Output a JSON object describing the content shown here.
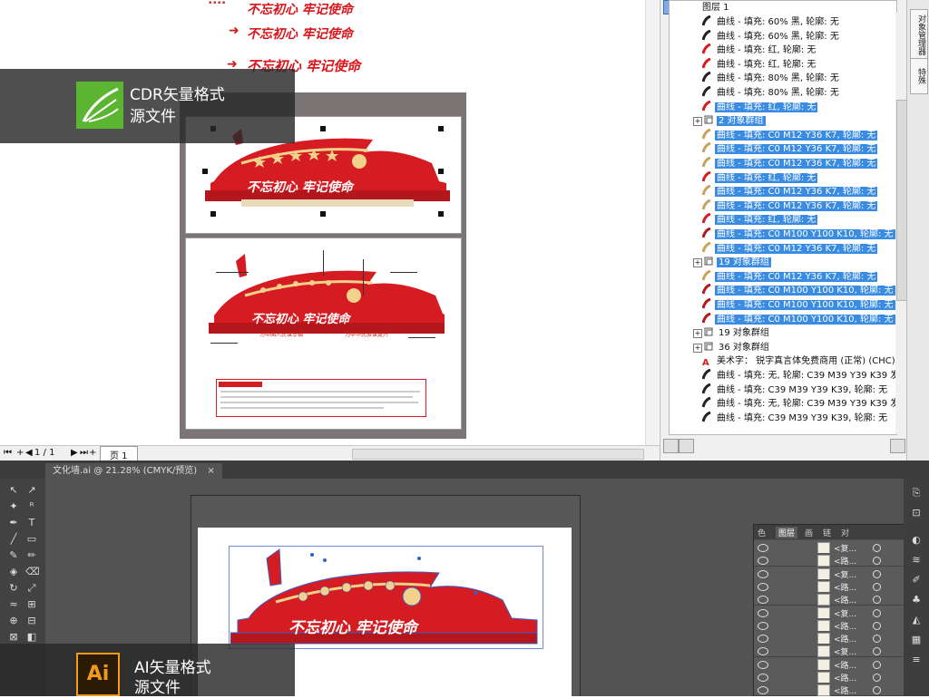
{
  "top_section": {
    "header_lines": [
      {
        "text": "不忘初心 牢记使命"
      },
      {
        "text": "不忘初心 牢记使命"
      },
      {
        "text": "不忘初心 牢记使命"
      }
    ],
    "badge": {
      "line1": "CDR矢量格式",
      "line2": "源文件"
    },
    "artboard_small_text": {
      "slogan": "不忘初心  牢记使命",
      "label_left": "为中国人民谋幸福",
      "label_right": "为中华民族谋复兴"
    },
    "statusbar": {
      "page_count": "1 / 1",
      "page_tab": "页 1"
    }
  },
  "object_tree": {
    "layer": "图层 1",
    "rows": [
      {
        "label": "曲线 - 填充: 60% 黑, 轮廓: 无",
        "selected": false,
        "icon_color": "#222222",
        "indent": 2
      },
      {
        "label": "曲线 - 填充: 60% 黑, 轮廓: 无",
        "selected": false,
        "icon_color": "#222222",
        "indent": 2
      },
      {
        "label": "曲线 - 填充: 红, 轮廓: 无",
        "selected": false,
        "icon_color": "#d41c22",
        "indent": 2
      },
      {
        "label": "曲线 - 填充: 红, 轮廓: 无",
        "selected": false,
        "icon_color": "#d41c22",
        "indent": 2
      },
      {
        "label": "曲线 - 填充: 80% 黑, 轮廓: 无",
        "selected": false,
        "icon_color": "#222222",
        "indent": 2
      },
      {
        "label": "曲线 - 填充: 80% 黑, 轮廓: 无",
        "selected": false,
        "icon_color": "#222222",
        "indent": 2
      },
      {
        "label": "曲线 - 填充: 红, 轮廓: 无",
        "selected": true,
        "icon_color": "#d41c22",
        "indent": 2
      },
      {
        "label": "2 对象群组",
        "selected": true,
        "group": true,
        "indent": 1
      },
      {
        "label": "曲线 - 填充: C0 M12 Y36 K7, 轮廓: 无",
        "selected": true,
        "icon_color": "#c9a35a",
        "indent": 2
      },
      {
        "label": "曲线 - 填充: C0 M12 Y36 K7, 轮廓: 无",
        "selected": true,
        "icon_color": "#c9a35a",
        "indent": 2
      },
      {
        "label": "曲线 - 填充: C0 M12 Y36 K7, 轮廓: 无",
        "selected": true,
        "icon_color": "#c9a35a",
        "indent": 2
      },
      {
        "label": "曲线 - 填充: 红, 轮廓: 无",
        "selected": true,
        "icon_color": "#d41c22",
        "indent": 2
      },
      {
        "label": "曲线 - 填充: C0 M12 Y36 K7, 轮廓: 无",
        "selected": true,
        "icon_color": "#c9a35a",
        "indent": 2
      },
      {
        "label": "曲线 - 填充: C0 M12 Y36 K7, 轮廓: 无",
        "selected": true,
        "icon_color": "#c9a35a",
        "indent": 2
      },
      {
        "label": "曲线 - 填充: 红, 轮廓: 无",
        "selected": true,
        "icon_color": "#d41c22",
        "indent": 2
      },
      {
        "label": "曲线 - 填充: C0 M100 Y100 K10, 轮廓: 无",
        "selected": true,
        "icon_color": "#b3161b",
        "indent": 2
      },
      {
        "label": "曲线 - 填充: C0 M12 Y36 K7, 轮廓: 无",
        "selected": true,
        "icon_color": "#c9a35a",
        "indent": 2
      },
      {
        "label": "19 对象群组",
        "selected": true,
        "group": true,
        "indent": 1
      },
      {
        "label": "曲线 - 填充: C0 M12 Y36 K7, 轮廓: 无",
        "selected": true,
        "icon_color": "#c9a35a",
        "indent": 2
      },
      {
        "label": "曲线 - 填充: C0 M100 Y100 K10, 轮廓: 无",
        "selected": true,
        "icon_color": "#b3161b",
        "indent": 2
      },
      {
        "label": "曲线 - 填充: C0 M100 Y100 K10, 轮廓: 无",
        "selected": true,
        "icon_color": "#b3161b",
        "indent": 2
      },
      {
        "label": "曲线 - 填充: C0 M100 Y100 K10, 轮廓: 无",
        "selected": true,
        "icon_color": "#b3161b",
        "indent": 2
      },
      {
        "label": "19 对象群组",
        "selected": false,
        "group": true,
        "indent": 1
      },
      {
        "label": "36 对象群组",
        "selected": false,
        "group": true,
        "indent": 1
      },
      {
        "label": "美术字： 锐字真言体免费商用 (正常) (CHC) - 文",
        "selected": false,
        "text_icon": true,
        "indent": 2
      },
      {
        "label": "曲线 - 填充: 无, 轮廓: C39 M39 Y39 K39 发丝",
        "selected": false,
        "icon_color": "#222222",
        "indent": 2
      },
      {
        "label": "曲线 - 填充: C39 M39 Y39 K39, 轮廓: 无",
        "selected": false,
        "icon_color": "#222222",
        "indent": 2
      },
      {
        "label": "曲线 - 填充: 无, 轮廓: C39 M39 Y39 K39 发丝",
        "selected": false,
        "icon_color": "#222222",
        "indent": 2
      },
      {
        "label": "曲线 - 填充: C39 M39 Y39 K39, 轮廓: 无",
        "selected": false,
        "icon_color": "#222222",
        "indent": 2
      }
    ]
  },
  "side_tabs": [
    "对象管理器",
    "特殊"
  ],
  "illustrator": {
    "doc_tab": "文化墙.ai @ 21.28% (CMYK/预览)",
    "badge": {
      "icon": "Ai",
      "line1": "AI矢量格式",
      "line2": "源文件"
    },
    "artboard_slogan": "不忘初心  牢记使命",
    "layers_tabs": [
      "色",
      "图层",
      "画",
      "链",
      "对"
    ],
    "layers": [
      {
        "name": "<复..."
      },
      {
        "name": "<路..."
      },
      {
        "name": "<复..."
      },
      {
        "name": "<路..."
      },
      {
        "name": "<路..."
      },
      {
        "name": "<复..."
      },
      {
        "name": "<路..."
      },
      {
        "name": "<路..."
      },
      {
        "name": "<复..."
      },
      {
        "name": "<路..."
      },
      {
        "name": "<路..."
      },
      {
        "name": "<路..."
      }
    ]
  }
}
